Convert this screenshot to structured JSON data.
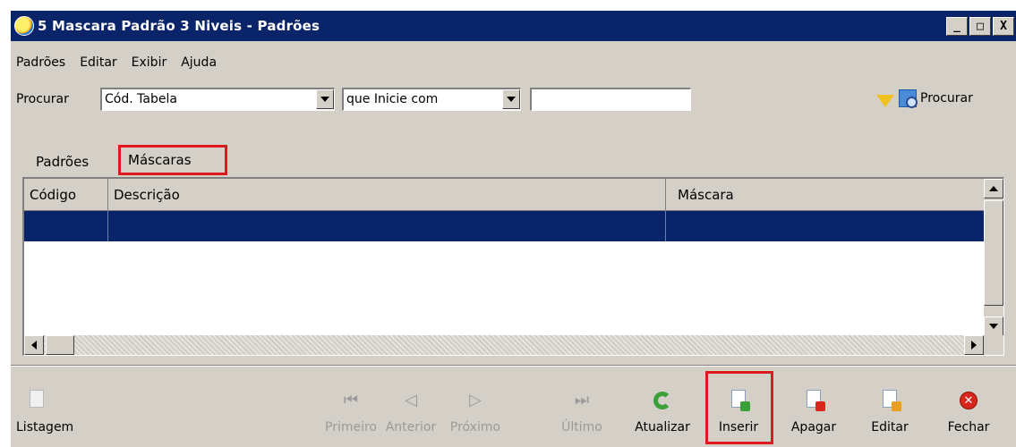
{
  "window": {
    "title": "5 Mascara Padrão 3 Niveis -  Padrões"
  },
  "window_buttons": [
    "_",
    "□",
    "X"
  ],
  "menu": [
    "Padrões",
    "Editar",
    "Exibir",
    "Ajuda"
  ],
  "search": {
    "label": "Procurar",
    "field_value": "Cód. Tabela",
    "operator_value": "que Inicie com",
    "text_value": "",
    "button_label": "Procurar"
  },
  "tabs": [
    {
      "label": "Padrões",
      "active": false
    },
    {
      "label": "Máscaras",
      "active": true,
      "highlighted": true
    }
  ],
  "table": {
    "columns": [
      "Código",
      "Descrição",
      "Máscara"
    ],
    "selected_row_color": "#0a246a"
  },
  "toolbar": {
    "listagem": "Listagem",
    "primeiro": "Primeiro",
    "anterior": "Anterior",
    "proximo": "Próximo",
    "ultimo": "Último",
    "atualizar": "Atualizar",
    "inserir": "Inserir",
    "apagar": "Apagar",
    "editar": "Editar",
    "fechar": "Fechar"
  },
  "colors": {
    "title_bar": "#0a246a",
    "face": "#d4d0c8",
    "highlight_box": "#e0191f"
  }
}
